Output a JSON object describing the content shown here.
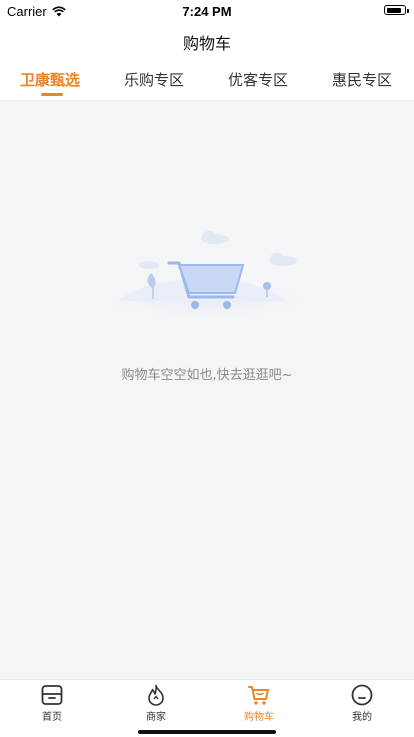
{
  "status_bar": {
    "carrier": "Carrier",
    "time": "7:24 PM"
  },
  "header": {
    "title": "购物车"
  },
  "tabs": [
    {
      "label": "卫康甄选",
      "active": true
    },
    {
      "label": "乐购专区",
      "active": false
    },
    {
      "label": "优客专区",
      "active": false
    },
    {
      "label": "惠民专区",
      "active": false
    }
  ],
  "empty_state": {
    "message": "购物车空空如也,快去逛逛吧~",
    "illustration": "empty-cart-illustration"
  },
  "tabbar": {
    "items": [
      {
        "label": "首页",
        "icon": "home-box-icon",
        "active": false
      },
      {
        "label": "商家",
        "icon": "flame-icon",
        "active": false
      },
      {
        "label": "购物车",
        "icon": "cart-icon",
        "active": true
      },
      {
        "label": "我的",
        "icon": "profile-icon",
        "active": false
      }
    ]
  },
  "colors": {
    "accent": "#e8862a",
    "background": "#f4f5f7"
  }
}
